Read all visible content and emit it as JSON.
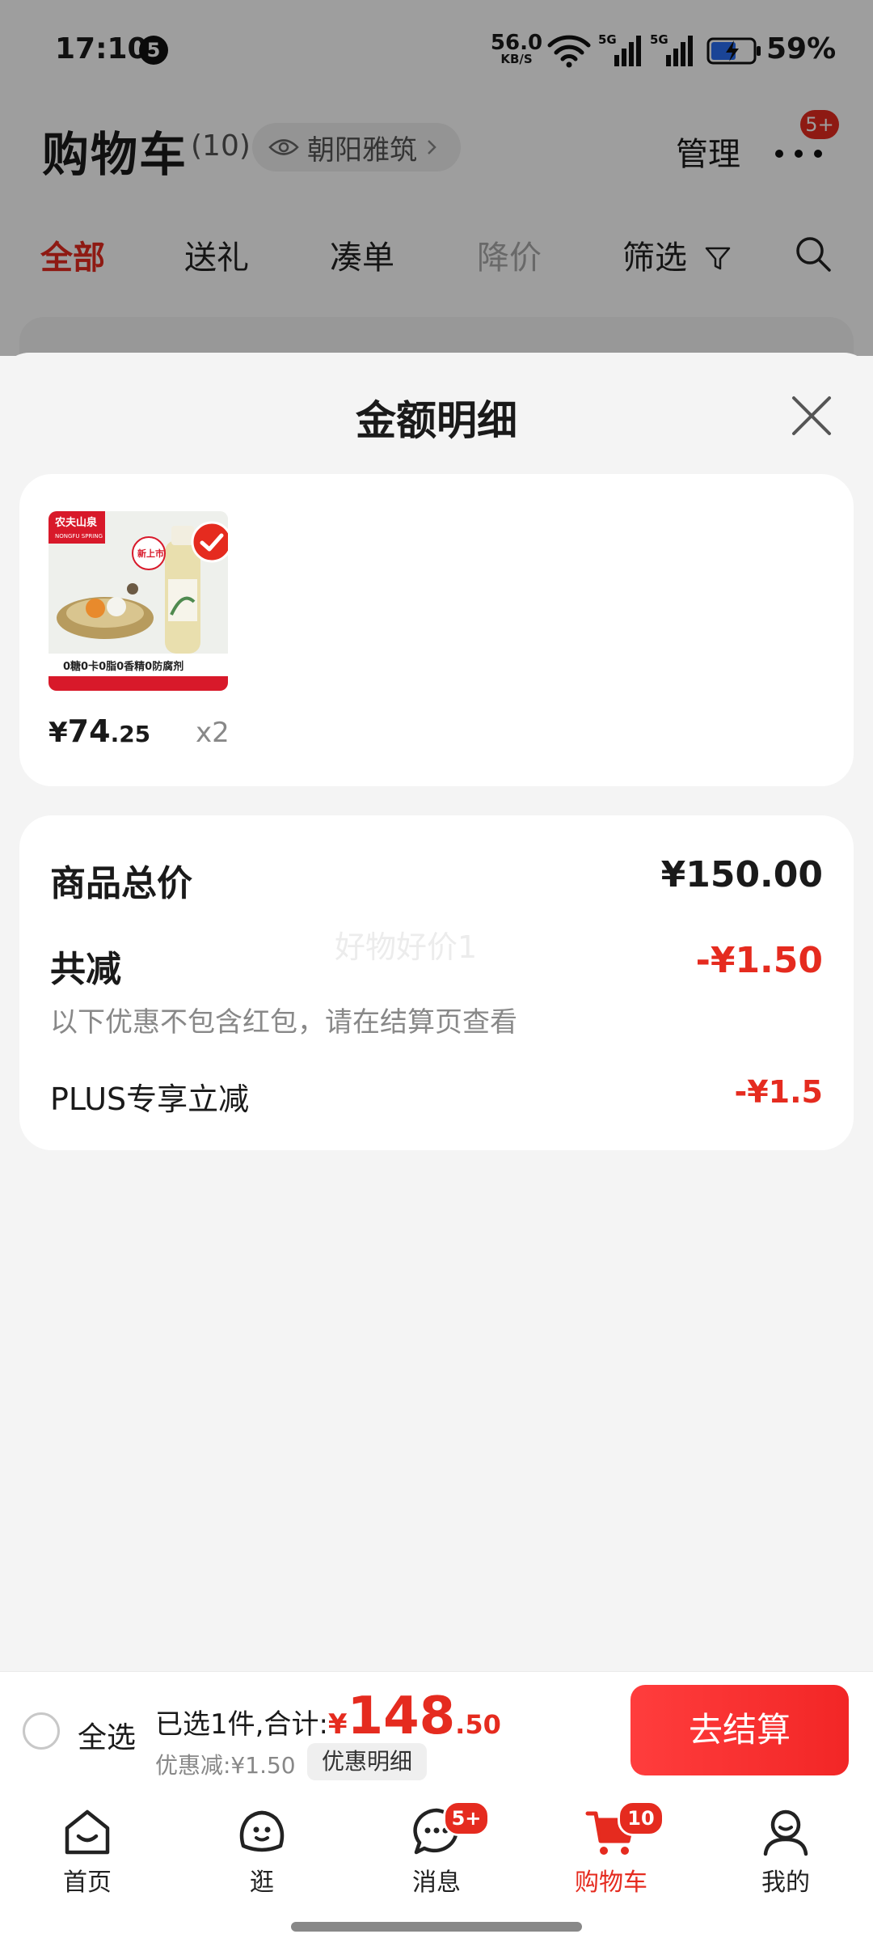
{
  "status_bar": {
    "time": "17:10",
    "notification_count": "5",
    "net_speed_value": "56.0",
    "net_speed_unit": "KB/S",
    "battery_percent": "59%",
    "network_labels": [
      "5G",
      "5G"
    ]
  },
  "header": {
    "title": "购物车",
    "count": "(10)",
    "location": "朝阳雅筑",
    "manage": "管理",
    "more_badge": "5+"
  },
  "filter_tabs": [
    "全部",
    "送礼",
    "凑单",
    "降价",
    "筛选"
  ],
  "sheet": {
    "title": "金额明细",
    "product": {
      "price_currency": "¥",
      "price_int": "74",
      "price_dec": ".25",
      "quantity": "x2",
      "thumb_brand": "农夫山泉",
      "thumb_brand_en": "NONGFU SPRING",
      "thumb_new_tag": "新上市",
      "thumb_tagline": "0糖0卡0脂0香精0防腐剂"
    },
    "summary": {
      "total_label": "商品总价",
      "total_value": "¥150.00",
      "reduce_label": "共减",
      "reduce_value": "-¥1.50",
      "reduce_note": "以下优惠不包含红包，请在结算页查看",
      "plus_label": "PLUS专享立减",
      "plus_value": "-¥1.5",
      "watermark": "好物好价1"
    }
  },
  "checkout": {
    "select_all": "全选",
    "selected_prefix": "已选1件,合计:",
    "amount_currency": "¥",
    "amount_int": "148",
    "amount_dec": ".50",
    "discount_text": "优惠减:¥1.50",
    "detail_button": "优惠明细",
    "checkout_button": "去结算"
  },
  "bottom_nav": [
    {
      "label": "首页",
      "badge": ""
    },
    {
      "label": "逛",
      "badge": ""
    },
    {
      "label": "消息",
      "badge": "5+"
    },
    {
      "label": "购物车",
      "badge": "10"
    },
    {
      "label": "我的",
      "badge": ""
    }
  ],
  "colors": {
    "accent": "#e52b1f",
    "checkout_gradient_start": "#ff3d3d",
    "checkout_gradient_end": "#f22626",
    "sheet_background": "#f4f4f4"
  },
  "icons": [
    "eye-icon",
    "chevron-right-icon",
    "more-dots-icon",
    "filter-funnel-icon",
    "search-icon",
    "close-icon",
    "check-circle-icon",
    "home-icon",
    "browse-icon",
    "message-icon",
    "cart-icon",
    "profile-icon",
    "wifi-icon",
    "signal-icon",
    "battery-icon"
  ]
}
